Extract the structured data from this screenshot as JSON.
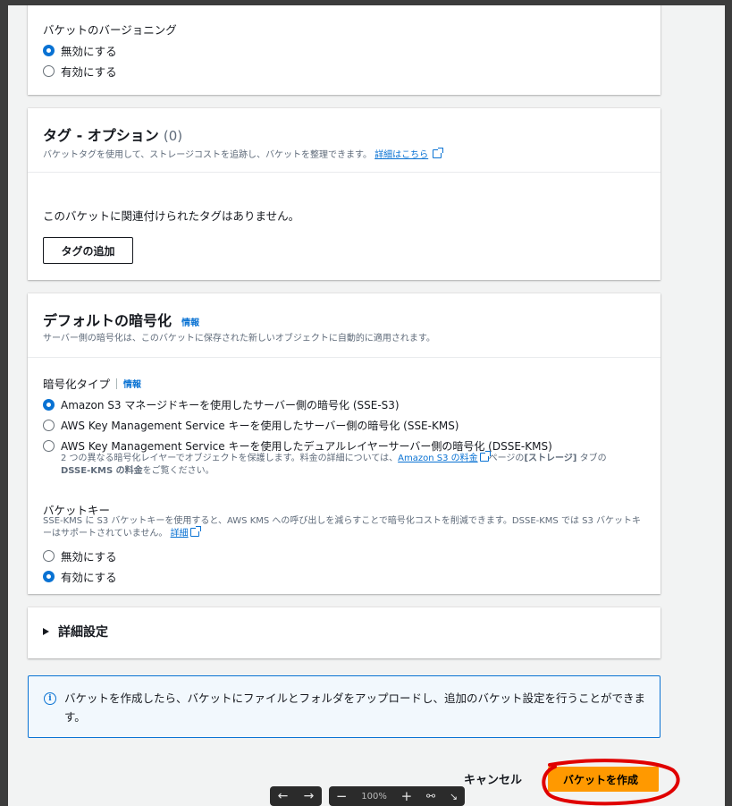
{
  "versioning": {
    "title": "バケットのバージョニング",
    "options": [
      "無効にする",
      "有効にする"
    ],
    "selected": 0
  },
  "tags": {
    "title": "タグ - オプション",
    "count": "(0)",
    "description": "バケットタグを使用して、ストレージコストを追跡し、バケットを整理できます。",
    "learn_more": "詳細はこちら",
    "empty_text": "このバケットに関連付けられたタグはありません。",
    "add_button": "タグの追加"
  },
  "encryption": {
    "title": "デフォルトの暗号化",
    "info": "情報",
    "description": "サーバー側の暗号化は、このバケットに保存された新しいオブジェクトに自動的に適用されます。",
    "type_label": "暗号化タイプ",
    "type_info": "情報",
    "options": [
      "Amazon S3 マネージドキーを使用したサーバー側の暗号化 (SSE-S3)",
      "AWS Key Management Service キーを使用したサーバー側の暗号化 (SSE-KMS)",
      "AWS Key Management Service キーを使用したデュアルレイヤーサーバー側の暗号化 (DSSE-KMS)"
    ],
    "selected": 0,
    "dsse_desc_1": "2 つの異なる暗号化レイヤーでオブジェクトを保護します。料金の詳細については、",
    "dsse_link": "Amazon S3 の料金",
    "dsse_desc_2": "ページの",
    "dsse_desc_bold1": "[ストレージ]",
    "dsse_desc_3": " タブの",
    "dsse_desc_bold2": "DSSE-KMS の料金",
    "dsse_desc_4": "をご覧ください。",
    "bucket_key": {
      "title": "バケットキー",
      "description": "SSE-KMS に S3 バケットキーを使用すると、AWS KMS への呼び出しを減らすことで暗号化コストを削減できます。DSSE-KMS では S3 バケットキーはサポートされていません。",
      "learn_more": "詳細",
      "options": [
        "無効にする",
        "有効にする"
      ],
      "selected": 1
    }
  },
  "advanced": {
    "title": "詳細設定"
  },
  "info_alert": {
    "text": "バケットを作成したら、バケットにファイルとフォルダをアップロードし、追加のバケット設定を行うことができます。"
  },
  "footer": {
    "cancel": "キャンセル",
    "create": "バケットを作成"
  },
  "viewer_toolbar": {
    "zoom": "100%"
  },
  "colors": {
    "primary": "#ff9900",
    "link": "#0972d3",
    "annotation": "#e00000"
  }
}
